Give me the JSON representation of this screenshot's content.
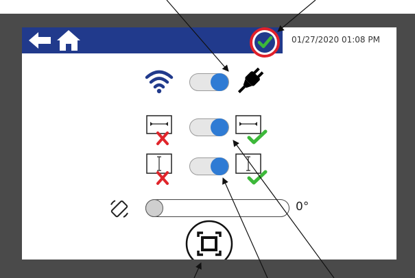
{
  "header": {
    "back_icon": "arrow-left-icon",
    "home_icon": "home-icon",
    "status_icon": "check-circle-icon",
    "datetime": "01/27/2020 01:08 PM"
  },
  "connection": {
    "wifi_icon": "wifi-icon",
    "power_icon": "plug-icon",
    "toggle_on": true
  },
  "orientation_toggles": [
    {
      "name": "horizontal",
      "on": true
    },
    {
      "name": "vertical",
      "on": true
    }
  ],
  "rotation": {
    "icon": "rotate-screen-icon",
    "value": 0,
    "label": "0°"
  },
  "fullscreen": {
    "icon": "fullscreen-icon"
  },
  "colors": {
    "topbar": "#213a8c",
    "toggle_on": "#2f7bd4",
    "check_green": "#3db83a",
    "cross_red": "#e0252b",
    "highlight_ring": "#e0202a"
  }
}
